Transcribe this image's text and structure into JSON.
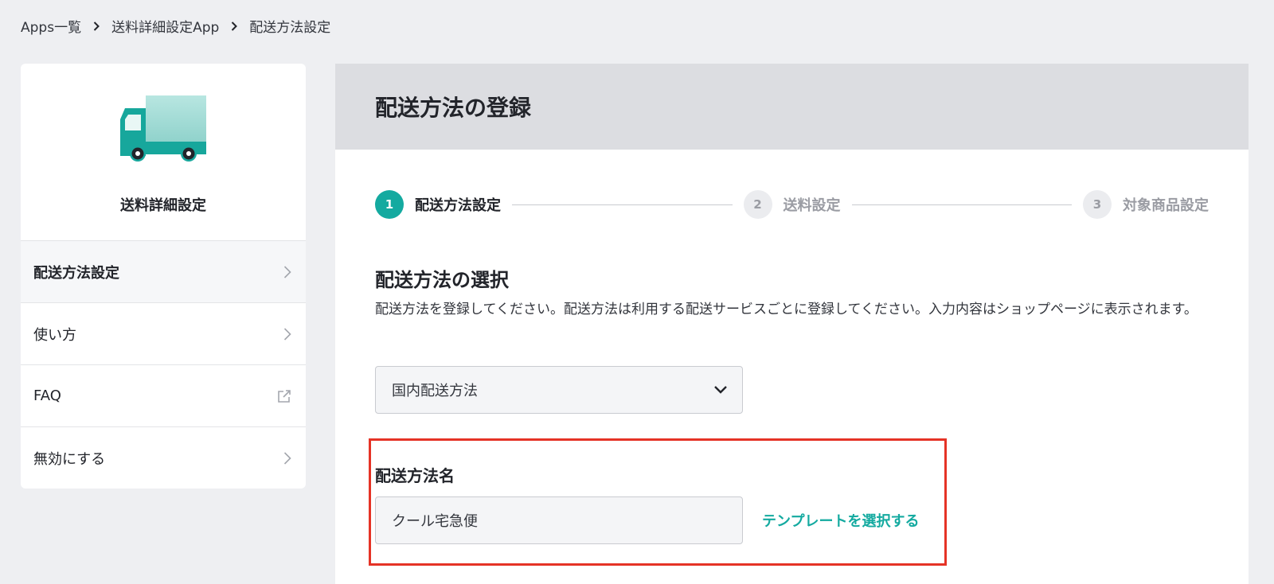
{
  "breadcrumb": {
    "items": [
      "Apps一覧",
      "送料詳細設定App",
      "配送方法設定"
    ]
  },
  "sidebar": {
    "app_name": "送料詳細設定",
    "items": [
      {
        "label": "配送方法設定",
        "icon": "chevron-right-icon"
      },
      {
        "label": "使い方",
        "icon": "chevron-right-icon"
      },
      {
        "label": "FAQ",
        "icon": "external-link-icon"
      },
      {
        "label": "無効にする",
        "icon": "chevron-right-icon"
      }
    ]
  },
  "main": {
    "title": "配送方法の登録",
    "steps": [
      {
        "number": "1",
        "label": "配送方法設定",
        "state": "active"
      },
      {
        "number": "2",
        "label": "送料設定",
        "state": "inactive"
      },
      {
        "number": "3",
        "label": "対象商品設定",
        "state": "inactive"
      }
    ],
    "section_title": "配送方法の選択",
    "section_desc": "配送方法を登録してください。配送方法は利用する配送サービスごとに登録してください。入力内容はショップページに表示されます。",
    "method_select": {
      "value": "国内配送方法"
    },
    "name_field": {
      "label": "配送方法名",
      "value": "クール宅急便"
    },
    "template_link": "テンプレートを選択する"
  },
  "colors": {
    "accent": "#14aaa0",
    "highlight_border": "#e53326",
    "header_bg": "#dcdde1",
    "page_bg": "#eeeff2"
  }
}
